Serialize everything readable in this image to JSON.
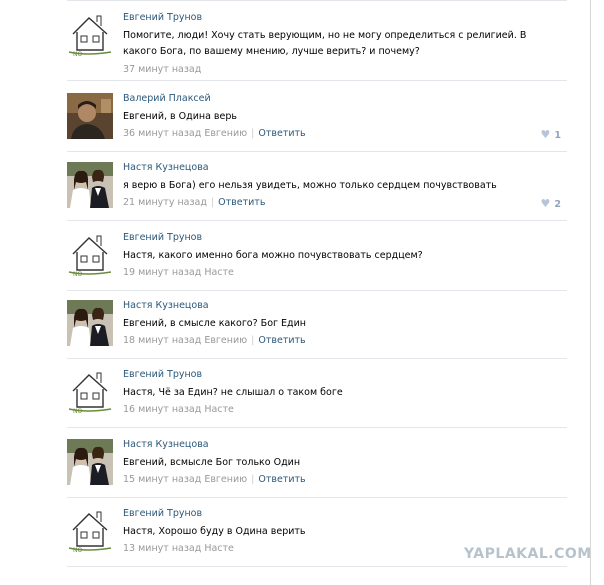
{
  "comments": [
    {
      "author": "Евгений Трунов",
      "avatar": "house-drawing",
      "text": "Помогите, люди! Хочу стать верующим, но не могу определиться с религией. В какого Бога, по вашему мнению, лучше верить? и почему?",
      "time": "37 минут назад",
      "reply_to": "",
      "reply_label": "",
      "likes": ""
    },
    {
      "author": "Валерий Плаксей",
      "avatar": "man-photo",
      "text": "Евгений, в Одина верь",
      "time": "36 минут назад Евгению",
      "reply_to": "",
      "reply_label": "Ответить",
      "likes": "1"
    },
    {
      "author": "Настя Кузнецова",
      "avatar": "two-girls-photo",
      "text": "я верю в Бога) его нельзя увидеть, можно только сердцем почувствовать",
      "time": "21 минуту назад",
      "reply_to": "",
      "reply_label": "Ответить",
      "likes": "2"
    },
    {
      "author": "Евгений Трунов",
      "avatar": "house-drawing",
      "text": "Настя, какого именно бога можно почувствовать сердцем?",
      "time": "19 минут назад Насте",
      "reply_to": "",
      "reply_label": "",
      "likes": ""
    },
    {
      "author": "Настя Кузнецова",
      "avatar": "two-girls-photo",
      "text": "Евгений, в смысле какого? Бог Един",
      "time": "18 минут назад Евгению",
      "reply_to": "",
      "reply_label": "Ответить",
      "likes": ""
    },
    {
      "author": "Евгений Трунов",
      "avatar": "house-drawing",
      "text": "Настя, Чё за Един? не слышал о таком боге",
      "time": "16 минут назад Насте",
      "reply_to": "",
      "reply_label": "",
      "likes": ""
    },
    {
      "author": "Настя Кузнецова",
      "avatar": "two-girls-photo",
      "text": "Евгений, всмысле Бог только Один",
      "time": "15 минут назад Евгению",
      "reply_to": "",
      "reply_label": "Ответить",
      "likes": ""
    },
    {
      "author": "Евгений Трунов",
      "avatar": "house-drawing",
      "text": "Настя, Хорошо буду в Одина верить",
      "time": "13 минут назад Насте",
      "reply_to": "",
      "reply_label": "",
      "likes": ""
    }
  ],
  "watermark": "YAPLAKAL.COM",
  "colors": {
    "link": "#2b587a",
    "meta": "#999999",
    "divider": "#e3e6ea",
    "like": "#8fa6be"
  }
}
